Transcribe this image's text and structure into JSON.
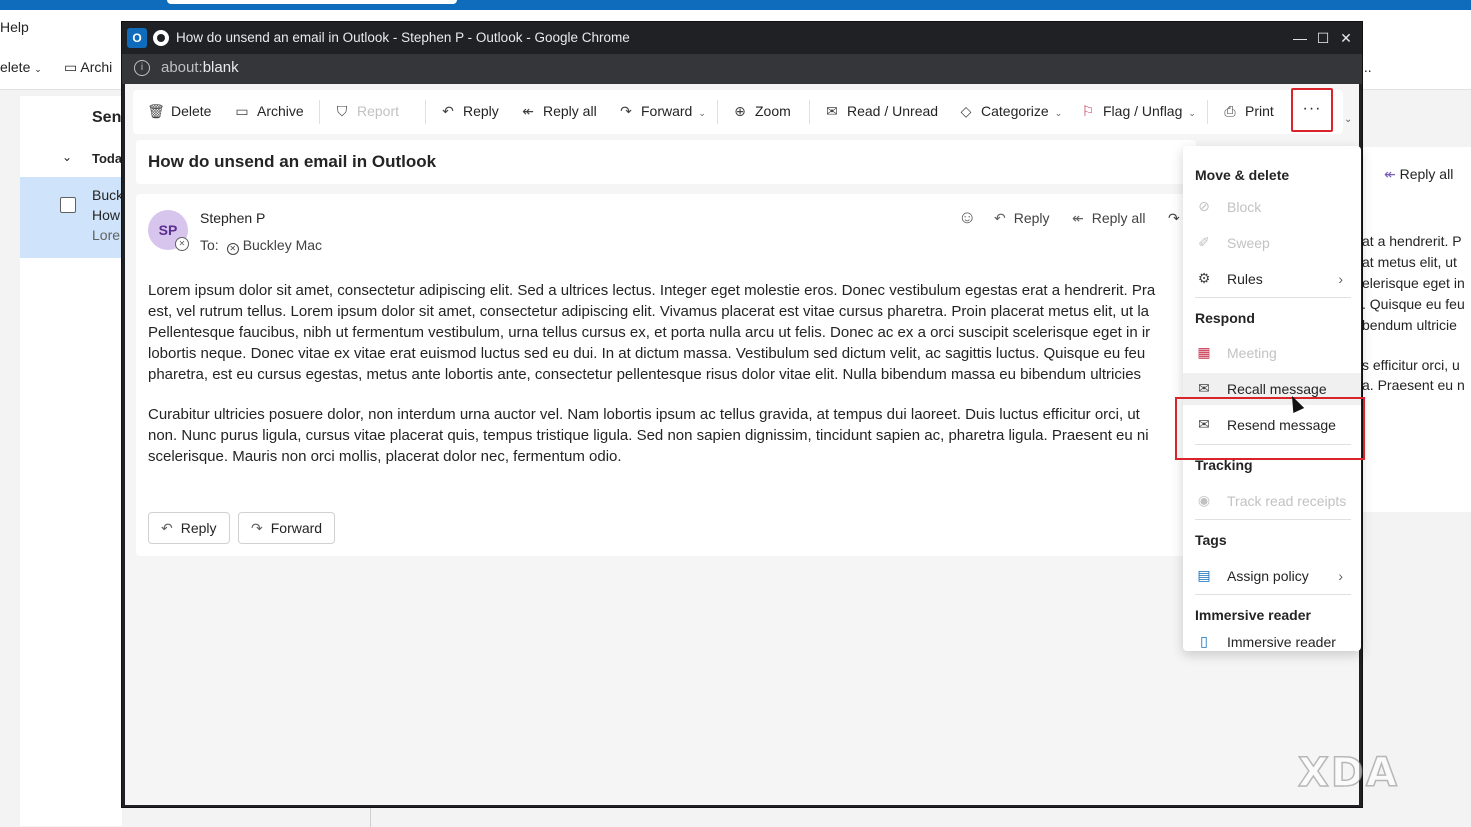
{
  "background": {
    "help": "Help",
    "ribbon": {
      "delete": "elete",
      "archive": "Archi",
      "more": "..."
    },
    "folder": {
      "sent": "Sent",
      "today": "Toda"
    },
    "list_item": {
      "line1": "Buck",
      "line2": "How",
      "line3": "Lore"
    },
    "right_pane": {
      "reply_all": "Reply all",
      "lines": [
        "at a hendrerit. P",
        "at metus elit, ut",
        "elerisque eget in",
        ". Quisque eu feu",
        "bendum ultricie",
        "s efficitur orci, u",
        "a. Praesent eu n"
      ]
    }
  },
  "window": {
    "title": "How do unsend an email in Outlook - Stephen P - Outlook - Google Chrome",
    "url_prefix": "about:",
    "url_rest": "blank",
    "controls": {
      "minimize": "—",
      "maximize": "☐",
      "close": "✕"
    }
  },
  "toolbar": {
    "delete": "Delete",
    "archive": "Archive",
    "report": "Report",
    "reply": "Reply",
    "reply_all": "Reply all",
    "forward": "Forward",
    "zoom": "Zoom",
    "read_unread": "Read / Unread",
    "categorize": "Categorize",
    "flag_unflag": "Flag / Unflag",
    "print": "Print",
    "more": "···"
  },
  "message": {
    "subject": "How do unsend an email in Outlook",
    "avatar_initials": "SP",
    "sender": "Stephen P",
    "to_label": "To:",
    "recipient": "Buckley Mac",
    "actions": {
      "reply": "Reply",
      "reply_all": "Reply all"
    },
    "paragraph1": [
      "Lorem ipsum dolor sit amet, consectetur adipiscing elit. Sed a ultrices lectus. Integer eget molestie eros. Donec vestibulum egestas erat a hendrerit. Pra",
      "est, vel rutrum tellus. Lorem ipsum dolor sit amet, consectetur adipiscing elit. Vivamus placerat est vitae cursus pharetra. Proin placerat metus elit, ut la",
      "Pellentesque faucibus, nibh ut fermentum vestibulum, urna tellus cursus ex, et porta nulla arcu ut felis. Donec ac ex a orci suscipit scelerisque eget in ir",
      "lobortis neque. Donec vitae ex vitae erat euismod luctus sed eu dui. In at dictum massa. Vestibulum sed dictum velit, ac sagittis luctus. Quisque eu feu",
      "pharetra, est eu cursus egestas, metus ante lobortis ante, consectetur pellentesque risus dolor vitae elit. Nulla bibendum massa eu bibendum ultricies"
    ],
    "paragraph2": [
      "Curabitur ultricies posuere dolor, non interdum urna auctor vel. Nam lobortis ipsum ac tellus gravida, at tempus dui laoreet. Duis luctus efficitur orci, ut",
      "non. Nunc purus ligula, cursus vitae placerat quis, tempus tristique ligula. Sed non sapien dignissim, tincidunt sapien ac, pharetra ligula. Praesent eu ni",
      "scelerisque. Mauris non orci mollis, placerat dolor nec, fermentum odio."
    ],
    "footer": {
      "reply": "Reply",
      "forward": "Forward"
    }
  },
  "menu": {
    "move_delete": "Move & delete",
    "block": "Block",
    "sweep": "Sweep",
    "rules": "Rules",
    "respond": "Respond",
    "meeting": "Meeting",
    "recall": "Recall message",
    "resend": "Resend message",
    "tracking": "Tracking",
    "track_read": "Track read receipts",
    "tags": "Tags",
    "assign_policy": "Assign policy",
    "immersive_head": "Immersive reader",
    "immersive": "Immersive reader"
  },
  "watermark": "XDA",
  "colors": {
    "accent": "#0f6cbd",
    "highlight": "#d9242b",
    "avatar": "#d7c5ee"
  }
}
